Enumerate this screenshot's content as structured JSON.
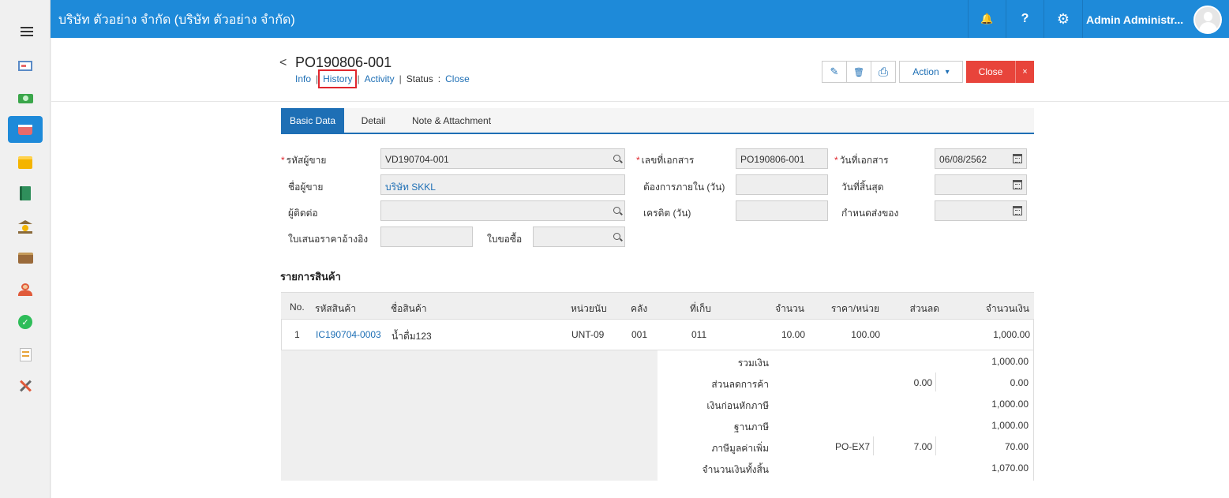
{
  "header": {
    "title": "บริษัท ตัวอย่าง จำกัด (บริษัท ตัวอย่าง จำกัด)",
    "user_name": "Admin Administr...",
    "bell_glyph": "🔔",
    "help_glyph": "?",
    "gear_glyph": "⚙"
  },
  "sidebar": {
    "items": [
      {
        "icon": "monitor-icon",
        "color": "#e86a6a"
      },
      {
        "icon": "money-icon",
        "color": "#3aa64a"
      },
      {
        "icon": "cart-icon",
        "color": "#ffffff",
        "active": true
      },
      {
        "icon": "box-icon",
        "color": "#f4b400"
      },
      {
        "icon": "book-icon",
        "color": "#2f8f5b"
      },
      {
        "icon": "bank-icon",
        "color": "#8a6a3a"
      },
      {
        "icon": "wallet-icon",
        "color": "#9a6a3a"
      },
      {
        "icon": "user-group-icon",
        "color": "#e05a3a"
      },
      {
        "icon": "check-icon",
        "color": "#2ebd59"
      },
      {
        "icon": "report-icon",
        "color": "#e8a43a"
      },
      {
        "icon": "tools-icon",
        "color": "#666666"
      }
    ]
  },
  "doc": {
    "back_glyph": "<",
    "title": "PO190806-001",
    "links": {
      "info": "Info",
      "history": "History",
      "activity": "Activity",
      "status_label": "Status",
      "status_colon": ":",
      "status_value": "Close",
      "separator": "|"
    }
  },
  "toolbar": {
    "edit_glyph": "✎",
    "delete_glyph": "🗑",
    "print_glyph": "⎙",
    "action_label": "Action",
    "action_caret": "▾",
    "close_label": "Close",
    "close_x": "×"
  },
  "tabs": [
    {
      "label": "Basic Data",
      "active": true
    },
    {
      "label": "Detail",
      "active": false
    },
    {
      "label": "Note & Attachment",
      "active": false
    }
  ],
  "form": {
    "required_mark": "*",
    "vendor_code_label": "รหัสผู้ขาย",
    "vendor_code_value": "VD190704-001",
    "vendor_name_label": "ชื่อผู้ขาย",
    "vendor_name_value": "บริษัท SKKL",
    "contact_label": "ผู้ติดต่อ",
    "contact_value": "",
    "quote_ref_label": "ใบเสนอราคาอ้างอิง",
    "quote_ref_value": "",
    "pr_label": "ใบขอซื้อ",
    "pr_value": "",
    "doc_no_label": "เลขที่เอกสาร",
    "doc_no_value": "PO190806-001",
    "within_days_label": "ต้องการภายใน (วัน)",
    "within_days_value": "",
    "credit_days_label": "เครดิต (วัน)",
    "credit_days_value": "",
    "doc_date_label": "วันที่เอกสาร",
    "doc_date_value": "06/08/2562",
    "end_date_label": "วันที่สิ้นสุด",
    "end_date_value": "",
    "delivery_label": "กำหนดส่งของ",
    "delivery_value": ""
  },
  "items_section": {
    "title": "รายการสินค้า",
    "headers": {
      "no": "No.",
      "code": "รหัสสินค้า",
      "name": "ชื่อสินค้า",
      "unit": "หน่วยนับ",
      "warehouse": "คลัง",
      "location": "ที่เก็บ",
      "qty": "จำนวน",
      "price": "ราคา/หน่วย",
      "discount": "ส่วนลด",
      "amount": "จำนวนเงิน"
    },
    "rows": [
      {
        "no": "1",
        "code": "IC190704-0003",
        "name": "น้ำดื่ม123",
        "unit": "UNT-09",
        "warehouse": "001",
        "location": "011",
        "qty": "10.00",
        "price": "100.00",
        "discount": "",
        "amount": "1,000.00"
      }
    ]
  },
  "summary": {
    "total_label": "รวมเงิน",
    "total_value": "1,000.00",
    "trade_discount_label": "ส่วนลดการค้า",
    "trade_discount_rate": "0.00",
    "trade_discount_value": "0.00",
    "before_tax_label": "เงินก่อนหักภาษี",
    "before_tax_value": "1,000.00",
    "tax_base_label": "ฐานภาษี",
    "tax_base_value": "1,000.00",
    "vat_label": "ภาษีมูลค่าเพิ่ม",
    "vat_code": "PO-EX7",
    "vat_rate": "7.00",
    "vat_value": "70.00",
    "grand_total_label": "จำนวนเงินทั้งสิ้น",
    "grand_total_value": "1,070.00"
  }
}
